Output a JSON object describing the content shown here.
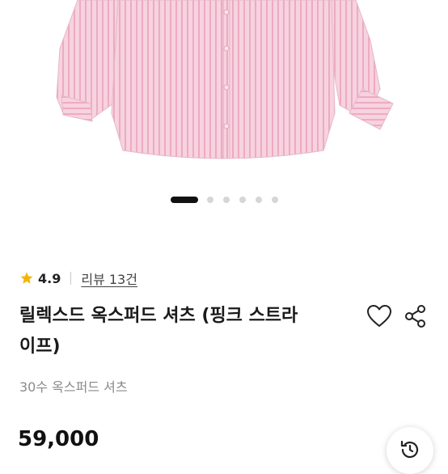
{
  "product_image": {
    "alt": "",
    "colors": {
      "shirt": "#f5c9d8",
      "stripe": "#ee9fbb",
      "button": "#f7dce6"
    }
  },
  "carousel": {
    "total": 6,
    "active_index": 0
  },
  "rating": {
    "value": "4.9",
    "icon": "star-icon",
    "color": "#f5b400"
  },
  "reviews": {
    "label": "리뷰 13건"
  },
  "product": {
    "title_line1": "릴렉스드 옥스퍼드 셔츠 (핑크 스트라",
    "title_line2": "이프)",
    "subtitle": "30수 옥스퍼드 셔츠",
    "price": "59,000"
  },
  "actions": {
    "wishlist_icon": "heart-icon",
    "share_icon": "share-icon",
    "history_icon": "history-icon"
  }
}
